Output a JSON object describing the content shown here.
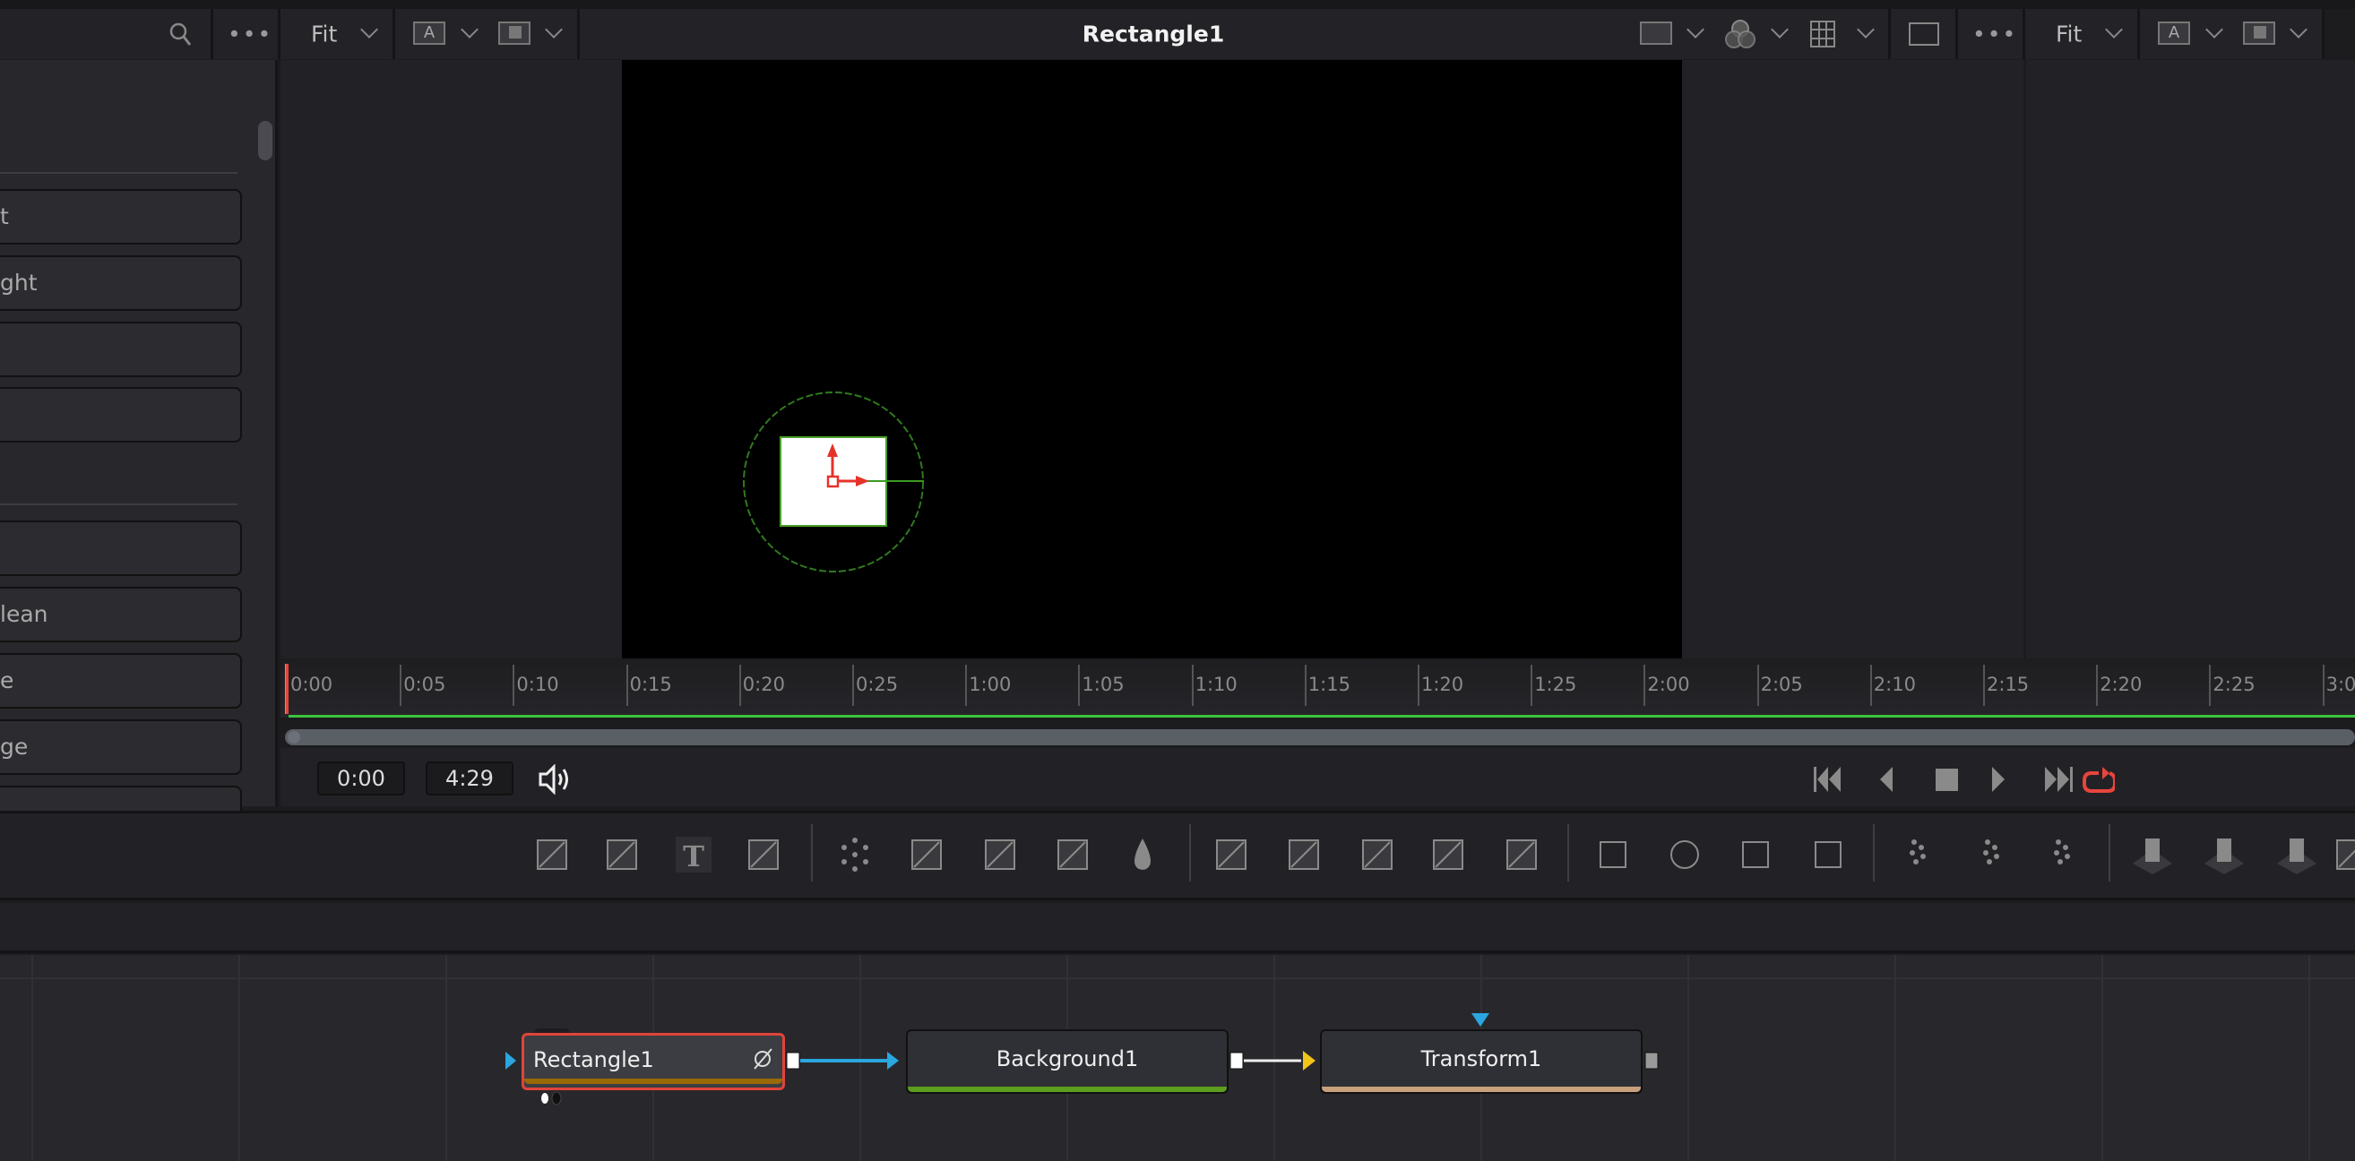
{
  "viewer": {
    "title": "Rectangle1",
    "fit_label": "Fit",
    "fit2_label": "Fit",
    "a_label": "A",
    "a2_label": "A"
  },
  "left_panel": {
    "buttons": [
      "t",
      "ght",
      "",
      "",
      "",
      "lean",
      "e",
      "ge",
      ""
    ]
  },
  "timeline": {
    "ticks": [
      "0:00",
      "0:05",
      "0:10",
      "0:15",
      "0:20",
      "0:25",
      "1:00",
      "1:05",
      "1:10",
      "1:15",
      "1:20",
      "1:25",
      "2:00",
      "2:05",
      "2:10",
      "2:15",
      "2:20",
      "2:25",
      "3:00"
    ],
    "current_time": "0:00",
    "end_time": "4:29",
    "loop_color": "#e8453c"
  },
  "toolbar": {
    "groups": [
      [
        "background-icon",
        "fast-noise-icon",
        "text-icon",
        "paint-icon"
      ],
      [
        "blur-icon",
        "color-curves-icon",
        "color-correct-icon",
        "brightness-contrast-icon",
        "color-drop-icon"
      ],
      [
        "merge-icon",
        "multi-merge-icon",
        "matte-control-icon",
        "luma-keyer-icon",
        "transform-icon"
      ],
      [
        "rectangle-mask-icon",
        "ellipse-mask-icon",
        "polygon-mask-icon",
        "bspline-mask-icon"
      ],
      [
        "particle-emitter-icon",
        "particle-render-icon",
        "particle-region-icon"
      ],
      [
        "image-plane-3d-icon",
        "shape-3d-icon",
        "text-3d-icon",
        "unknown-icon"
      ]
    ]
  },
  "nodes": [
    {
      "label": "Rectangle1",
      "bar_color": "#9a6a08",
      "selected": true
    },
    {
      "label": "Background1",
      "bar_color": "#5c9e1e"
    },
    {
      "label": "Transform1",
      "bar_color": "#c9a07c"
    }
  ],
  "colors": {
    "link": "#2aa6e0",
    "selection": "#e0443a",
    "input_yellow": "#f2c318",
    "gizmo": "#e5332a",
    "outline": "#4aa02a"
  }
}
